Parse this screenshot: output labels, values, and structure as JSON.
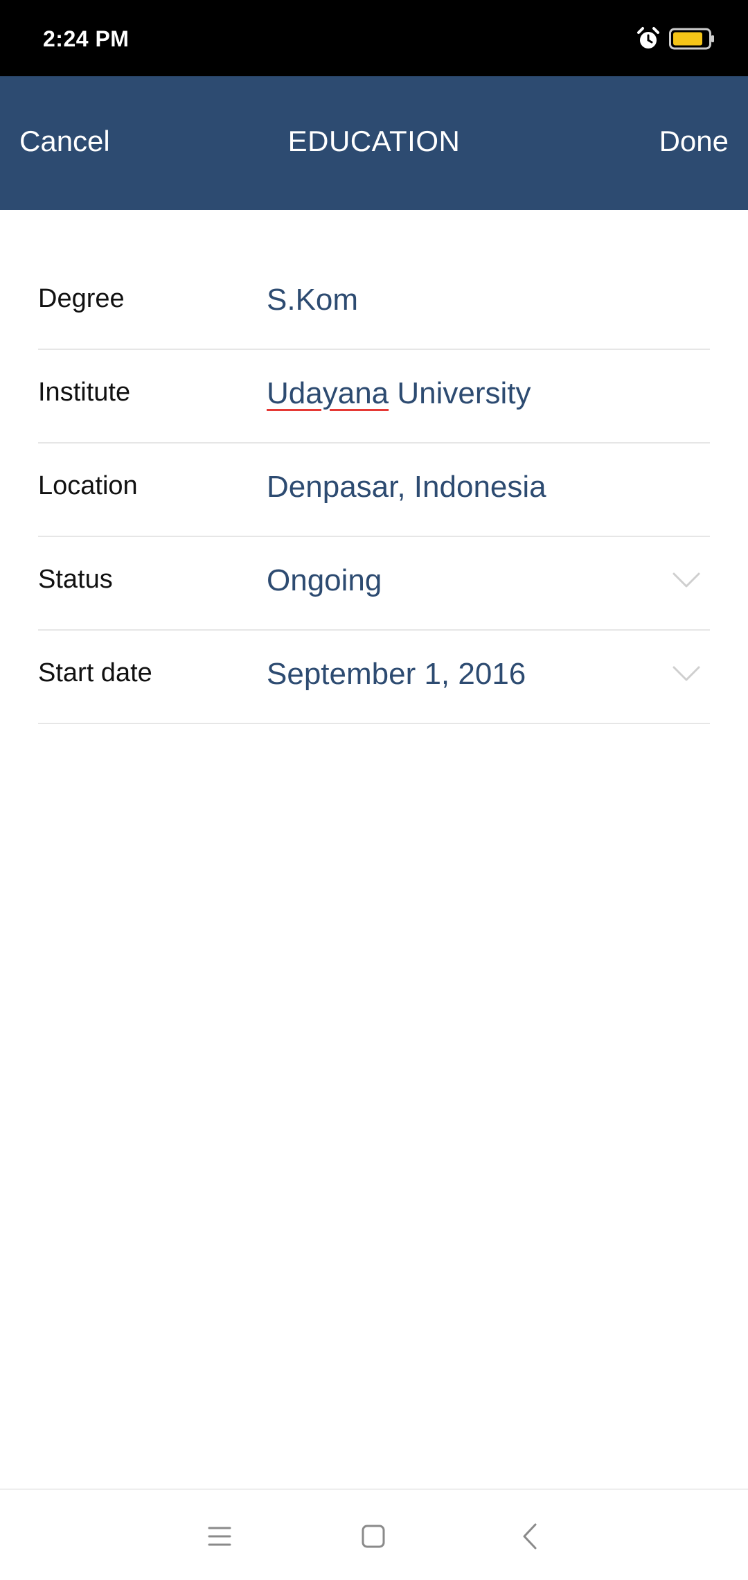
{
  "status_bar": {
    "time": "2:24 PM",
    "icons": [
      "alarm-icon",
      "battery-icon"
    ],
    "battery_color": "#f5c518"
  },
  "app_bar": {
    "cancel_label": "Cancel",
    "title": "EDUCATION",
    "done_label": "Done",
    "background": "#2d4b71"
  },
  "form": {
    "degree": {
      "label": "Degree",
      "value": "S.Kom"
    },
    "institute": {
      "label": "Institute",
      "value_misspelled": "Udayana",
      "value_rest": " University"
    },
    "location": {
      "label": "Location",
      "value": "Denpasar, Indonesia"
    },
    "status": {
      "label": "Status",
      "value": "Ongoing"
    },
    "start_date": {
      "label": "Start date",
      "value": "September 1, 2016"
    }
  },
  "nav_bar": {
    "icons": [
      "menu-icon",
      "home-icon",
      "back-icon"
    ]
  }
}
